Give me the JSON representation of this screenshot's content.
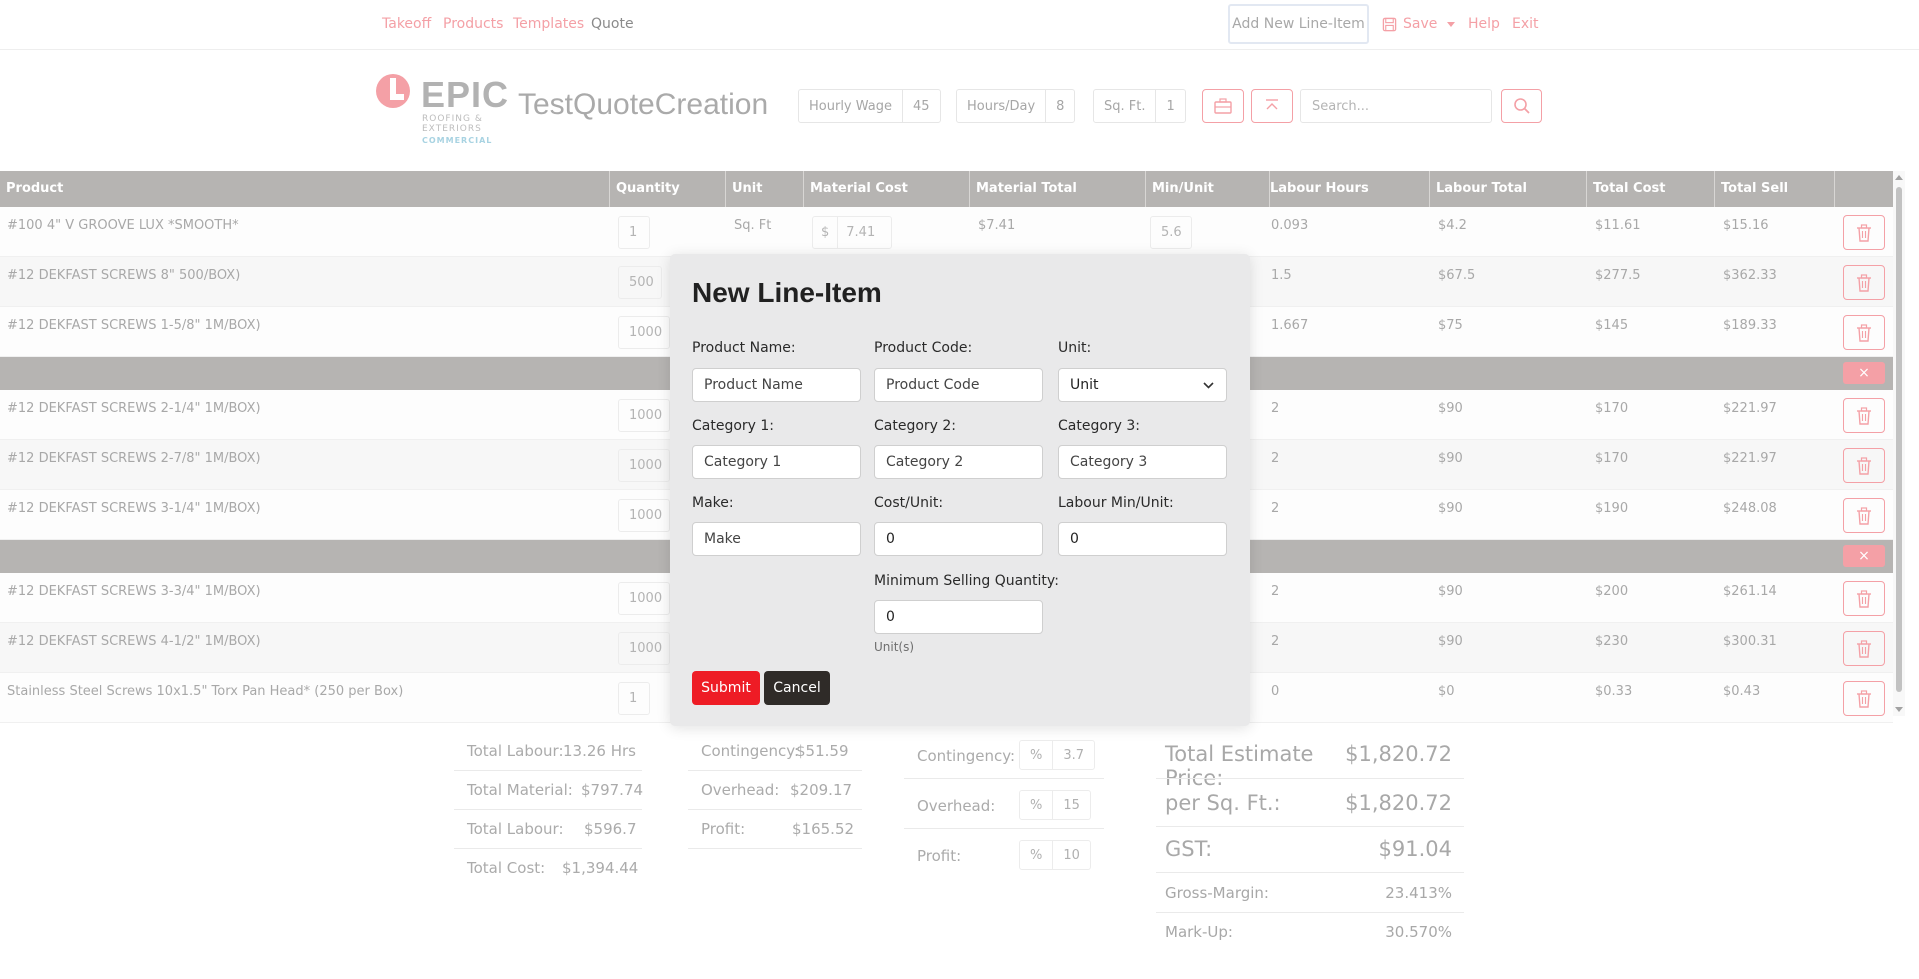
{
  "nav": {
    "takeoff": "Takeoff",
    "products": "Products",
    "templates": "Templates",
    "quote": "Quote",
    "add_new": "Add New Line-Item",
    "save": "Save",
    "help": "Help",
    "exit": "Exit"
  },
  "logo": {
    "brand": "EPIC",
    "line1": "ROOFING &",
    "line2": "EXTERIORS",
    "line3": "COMMERCIAL"
  },
  "header": {
    "quote_name": "TestQuoteCreation",
    "hourly_wage_label": "Hourly Wage",
    "hourly_wage": "45",
    "hours_day_label": "Hours/Day",
    "hours_day": "8",
    "sqft_label": "Sq. Ft.",
    "sqft": "1",
    "search_placeholder": "Search..."
  },
  "table": {
    "headers": [
      "Product",
      "Quantity",
      "Unit",
      "Material Cost",
      "Material Total",
      "Min/Unit",
      "Labour Hours",
      "Labour Total",
      "Total Cost",
      "Total Sell"
    ],
    "rows": [
      {
        "product": "#100 4\" V GROOVE LUX *SMOOTH*",
        "qty": "1",
        "unit": "Sq. Ft",
        "currency": "$",
        "mat_cost": "7.41",
        "mat_total": "$7.41",
        "min_unit": "5.6",
        "labour_hours": "0.093",
        "labour_total": "$4.2",
        "total_cost": "$11.61",
        "total_sell": "$15.16"
      },
      {
        "product": "#12 DEKFAST SCREWS 8\" 500/BOX)",
        "qty": "500",
        "labour_hours": "1.5",
        "labour_total": "$67.5",
        "total_cost": "$277.5",
        "total_sell": "$362.33"
      },
      {
        "product": "#12 DEKFAST SCREWS 1-5/8\" 1M/BOX)",
        "qty": "1000",
        "labour_hours": "1.667",
        "labour_total": "$75",
        "total_cost": "$145",
        "total_sell": "$189.33"
      },
      {
        "product": "#12 DEKFAST SCREWS 2-1/4\" 1M/BOX)",
        "qty": "1000",
        "labour_hours": "2",
        "labour_total": "$90",
        "total_cost": "$170",
        "total_sell": "$221.97"
      },
      {
        "product": "#12 DEKFAST SCREWS 2-7/8\" 1M/BOX)",
        "qty": "1000",
        "labour_hours": "2",
        "labour_total": "$90",
        "total_cost": "$170",
        "total_sell": "$221.97"
      },
      {
        "product": "#12 DEKFAST SCREWS 3-1/4\" 1M/BOX)",
        "qty": "1000",
        "labour_hours": "2",
        "labour_total": "$90",
        "total_cost": "$190",
        "total_sell": "$248.08"
      },
      {
        "product": "#12 DEKFAST SCREWS 3-3/4\" 1M/BOX)",
        "qty": "1000",
        "labour_hours": "2",
        "labour_total": "$90",
        "total_cost": "$200",
        "total_sell": "$261.14"
      },
      {
        "product": "#12 DEKFAST SCREWS 4-1/2\" 1M/BOX)",
        "qty": "1000",
        "labour_hours": "2",
        "labour_total": "$90",
        "total_cost": "$230",
        "total_sell": "$300.31"
      },
      {
        "product": "Stainless Steel Screws 10x1.5\" Torx Pan Head* (250 per Box)",
        "qty": "1",
        "labour_hours": "0",
        "labour_total": "$0",
        "total_cost": "$0.33",
        "total_sell": "$0.43"
      }
    ],
    "group_close": "×"
  },
  "summary": {
    "total_labour_hrs_label": "Total Labour:",
    "total_labour_hrs": "13.26 Hrs",
    "total_material_label": "Total Material:",
    "total_material": "$797.74",
    "total_labour_label": "Total Labour:",
    "total_labour": "$596.7",
    "total_cost_label": "Total Cost:",
    "total_cost": "$1,394.44",
    "contingency_label": "Contingency:",
    "contingency": "$51.59",
    "overhead_label": "Overhead:",
    "overhead": "$209.17",
    "profit_label": "Profit:",
    "profit": "$165.52",
    "pct_symbol": "%",
    "contingency_pct": "3.7",
    "overhead_pct": "15",
    "profit_pct": "10",
    "total_estimate_label": "Total Estimate Price:",
    "total_estimate": "$1,820.72",
    "per_sqft_label": "per Sq. Ft.:",
    "per_sqft": "$1,820.72",
    "gst_label": "GST:",
    "gst": "$91.04",
    "gross_margin_label": "Gross-Margin:",
    "gross_margin": "23.413%",
    "markup_label": "Mark-Up:",
    "markup": "30.570%"
  },
  "modal": {
    "title": "New Line-Item",
    "product_name_label": "Product Name:",
    "product_name_placeholder": "Product Name",
    "product_code_label": "Product Code:",
    "product_code_placeholder": "Product Code",
    "unit_label": "Unit:",
    "unit_value": "Unit",
    "cat1_label": "Category 1:",
    "cat1_placeholder": "Category 1",
    "cat2_label": "Category 2:",
    "cat2_placeholder": "Category 2",
    "cat3_label": "Category 3:",
    "cat3_placeholder": "Category 3",
    "make_label": "Make:",
    "make_placeholder": "Make",
    "cost_unit_label": "Cost/Unit:",
    "cost_unit_value": "0",
    "labour_min_label": "Labour Min/Unit:",
    "labour_min_value": "0",
    "min_sell_label": "Minimum Selling Quantity:",
    "min_sell_value": "0",
    "unit_note": "Unit(s)",
    "submit": "Submit",
    "cancel": "Cancel"
  },
  "colors": {
    "accent": "#f4a0a6",
    "header_gray": "#b6b4b2",
    "submit_red": "#ee1c25",
    "cancel_dark": "#2f2b28"
  }
}
